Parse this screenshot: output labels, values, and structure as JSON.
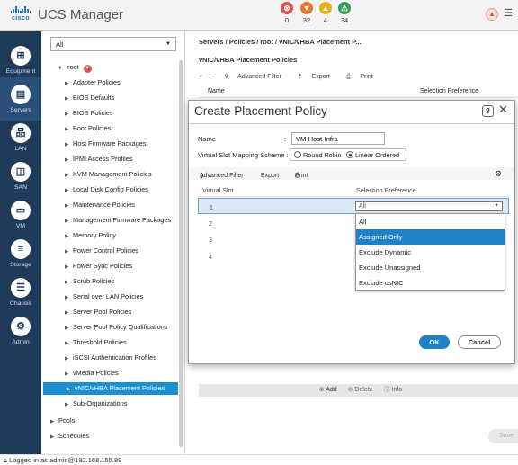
{
  "header": {
    "logo_text": "cisco",
    "title": "UCS Manager",
    "faults": [
      {
        "icon": "critical-icon",
        "symbol": "⊗",
        "count": "0",
        "color": "#d9534f"
      },
      {
        "icon": "major-icon",
        "symbol": "▼",
        "count": "32",
        "color": "#e8772e"
      },
      {
        "icon": "minor-icon",
        "symbol": "▲",
        "count": "4",
        "color": "#e8b21e"
      },
      {
        "icon": "warning-icon",
        "symbol": "⚠",
        "count": "34",
        "color": "#3a9a5b"
      }
    ]
  },
  "nav": [
    {
      "label": "Equipment",
      "icon": "equipment-icon",
      "glyph": "⊞"
    },
    {
      "label": "Servers",
      "icon": "servers-icon",
      "glyph": "▤"
    },
    {
      "label": "LAN",
      "icon": "lan-icon",
      "glyph": "品"
    },
    {
      "label": "SAN",
      "icon": "san-icon",
      "glyph": "◫"
    },
    {
      "label": "VM",
      "icon": "vm-icon",
      "glyph": "▭"
    },
    {
      "label": "Storage",
      "icon": "storage-icon",
      "glyph": "≡"
    },
    {
      "label": "Chassis",
      "icon": "chassis-icon",
      "glyph": "☰"
    },
    {
      "label": "Admin",
      "icon": "admin-icon",
      "glyph": "⚙"
    }
  ],
  "tree": {
    "filter_value": "All",
    "root_label": "root",
    "items": [
      "Adapter Policies",
      "BIOS Defaults",
      "BIOS Policies",
      "Boot Policies",
      "Host Firmware Packages",
      "IPMI Access Profiles",
      "KVM Management Policies",
      "Local Disk Config Policies",
      "Maintenance Policies",
      "Management Firmware Packages",
      "Memory Policy",
      "Power Control Policies",
      "Power Sync Policies",
      "Scrub Policies",
      "Serial over LAN Policies",
      "Server Pool Policies",
      "Server Pool Policy Qualifications",
      "Threshold Policies",
      "iSCSI Authentication Profiles",
      "vMedia Policies",
      "vNIC/vHBA Placement Policies",
      "Sub-Organizations"
    ],
    "selected_index": 20,
    "bottom_items": [
      "Pools",
      "Schedules"
    ]
  },
  "main": {
    "breadcrumb": "Servers / Policies / root / vNIC/vHBA Placement P...",
    "subtitle": "vNIC/vHBA Placement Policies",
    "toolbar": [
      "+",
      "−",
      "Advanced Filter",
      "Export",
      "Print"
    ],
    "columns": [
      "Name",
      "Selection Preference"
    ],
    "bottom_actions": [
      "Add",
      "Delete",
      "Info"
    ],
    "save_label": "Save"
  },
  "dialog": {
    "title": "Create Placement Policy",
    "help": "?",
    "name_label": "Name",
    "name_value": "VM-Host-Infra",
    "vsms_label": "Virtual Slot Mapping Scheme :",
    "radio_options": [
      "Round Robin",
      "Linear Ordered"
    ],
    "radio_selected": 1,
    "toolbar": [
      "Advanced Filter",
      "Export",
      "Print"
    ],
    "columns": [
      "Virtual Slot",
      "Selection Preference"
    ],
    "rows": [
      {
        "slot": "1",
        "pref": "All"
      },
      {
        "slot": "2",
        "pref": ""
      },
      {
        "slot": "3",
        "pref": ""
      },
      {
        "slot": "4",
        "pref": ""
      }
    ],
    "dropdown_options": [
      "All",
      "Assigned Only",
      "Exclude Dynamic",
      "Exclude Unassigned",
      "Exclude usNIC"
    ],
    "dropdown_highlighted": 1,
    "ok_label": "OK",
    "cancel_label": "Cancel"
  },
  "status": {
    "text": "Logged in as admin@192.168.155.89"
  }
}
